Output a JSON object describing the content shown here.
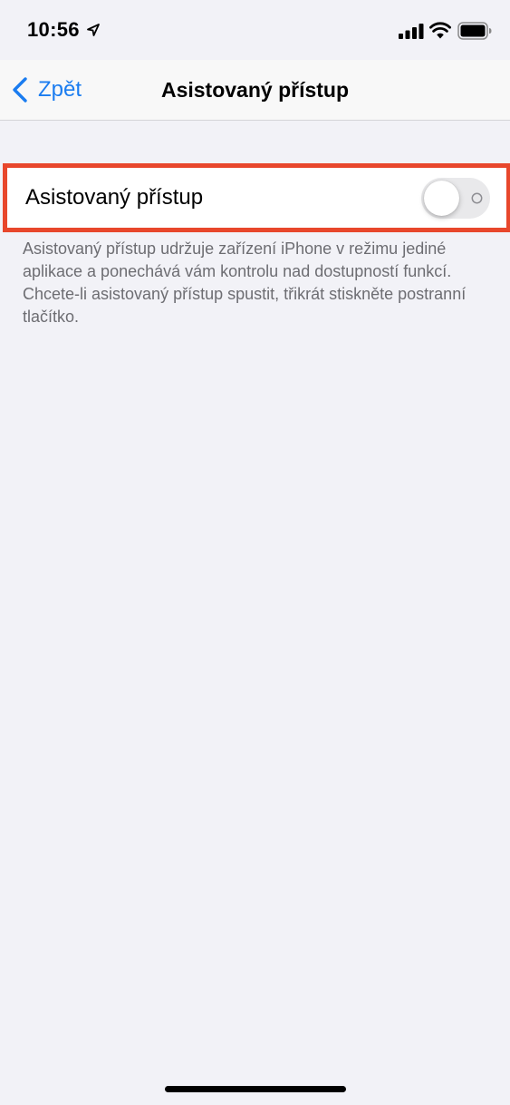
{
  "status_bar": {
    "time": "10:56",
    "icons": [
      "location-arrow-icon",
      "cellular-signal-icon",
      "wifi-icon",
      "battery-icon"
    ]
  },
  "nav": {
    "back_label": "Zpět",
    "title": "Asistovaný přístup"
  },
  "setting": {
    "label": "Asistovaný přístup",
    "toggle_state": "off",
    "footer": "Asistovaný přístup udržuje zařízení iPhone v režimu jediné aplikace a ponechává vám kontrolu nad dostupností funkcí. Chcete-li asistovaný přístup spustit, třikrát stiskněte postranní tlačítko."
  },
  "colors": {
    "accent": "#1a7cf0",
    "highlight": "#e8472c",
    "background": "#f2f2f7",
    "toggle_off": "#e9e9eb"
  }
}
